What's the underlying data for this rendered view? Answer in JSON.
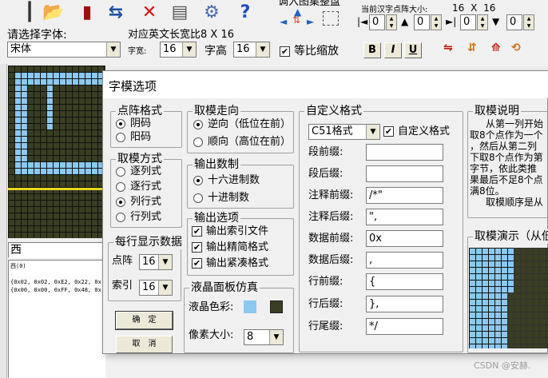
{
  "toolbar": {
    "top_partial_1": "调入图集整盘",
    "top_partial_2": "当前汉字点阵大小:",
    "size_w": "16",
    "size_x": "X",
    "size_h": "16",
    "spin_vals": [
      "0",
      "0",
      "0",
      "0"
    ]
  },
  "font_bar": {
    "choose_font_label": "请选择字体:",
    "font_name": "宋体",
    "en_width_label": "对应英文长宽比8 X 16",
    "char_width_label": "字宽:",
    "char_width_value": "16",
    "char_height_label": "字高",
    "char_height_value": "16",
    "proportional_label": "等比缩放",
    "bold_label": "B",
    "italic_label": "I",
    "underline_label": "U"
  },
  "left_panel": {
    "current_char": "西",
    "list_header": "西(0)",
    "code_line_1": "{0x02, 0x02, 0xE2, 0x22, 0x",
    "code_line_2": "{0x00, 0x00, 0xFF, 0x48, 0x"
  },
  "dialog": {
    "title": "字模选项",
    "dot_format": {
      "title": "点阵格式",
      "options": [
        "阴码",
        "阳码"
      ],
      "selected": 0
    },
    "take_mode": {
      "title": "取模方式",
      "options": [
        "逐列式",
        "逐行式",
        "列行式",
        "行列式"
      ],
      "selected": 2
    },
    "per_line": {
      "title": "每行显示数据",
      "dots_label": "点阵",
      "dots_value": "16",
      "index_label": "索引",
      "index_value": "16"
    },
    "buttons": {
      "ok": "确　定",
      "cancel": "取　消"
    },
    "direction": {
      "title": "取模走向",
      "options": [
        "逆向（低位在前）",
        "顺向（高位在前）"
      ],
      "selected": 0
    },
    "number_system": {
      "title": "输出数制",
      "options": [
        "十六进制数",
        "十进制数"
      ],
      "selected": 0
    },
    "output_options": {
      "title": "输出选项",
      "items": [
        "输出索引文件",
        "输出精简格式",
        "输出紧凑格式"
      ],
      "checked": [
        true,
        true,
        true
      ]
    },
    "lcd": {
      "title": "液晶面板仿真",
      "color_label": "液晶色彩:",
      "pixel_size_label": "像素大小:",
      "pixel_size_value": "8",
      "color_light": "#8cc8f0",
      "color_dark": "#3a3e22"
    },
    "custom_format": {
      "title": "自定义格式",
      "format_value": "C51格式",
      "custom_check_label": "自定义格式",
      "fields": [
        {
          "label": "段前缀:",
          "value": ""
        },
        {
          "label": "段后缀:",
          "value": ""
        },
        {
          "label": "注释前缀:",
          "value": "/*\""
        },
        {
          "label": "注释后缀:",
          "value": "\","
        },
        {
          "label": "数据前缀:",
          "value": "0x"
        },
        {
          "label": "数据后缀:",
          "value": ","
        },
        {
          "label": "行前缀:",
          "value": "{"
        },
        {
          "label": "行后缀:",
          "value": "},"
        },
        {
          "label": "行尾缀:",
          "value": "*/"
        }
      ]
    },
    "explain": {
      "title": "取模说明",
      "lines": [
        "从第一列开始",
        "取8个点作为一个",
        "，然后从第二列",
        "下取8个点作为第",
        "字节，依此类推",
        "果最后不足8个点",
        "满8位。",
        "取模顺序是从"
      ]
    },
    "demo": {
      "title": "取模演示（从低位"
    }
  },
  "watermark": "CSDN @安赫."
}
